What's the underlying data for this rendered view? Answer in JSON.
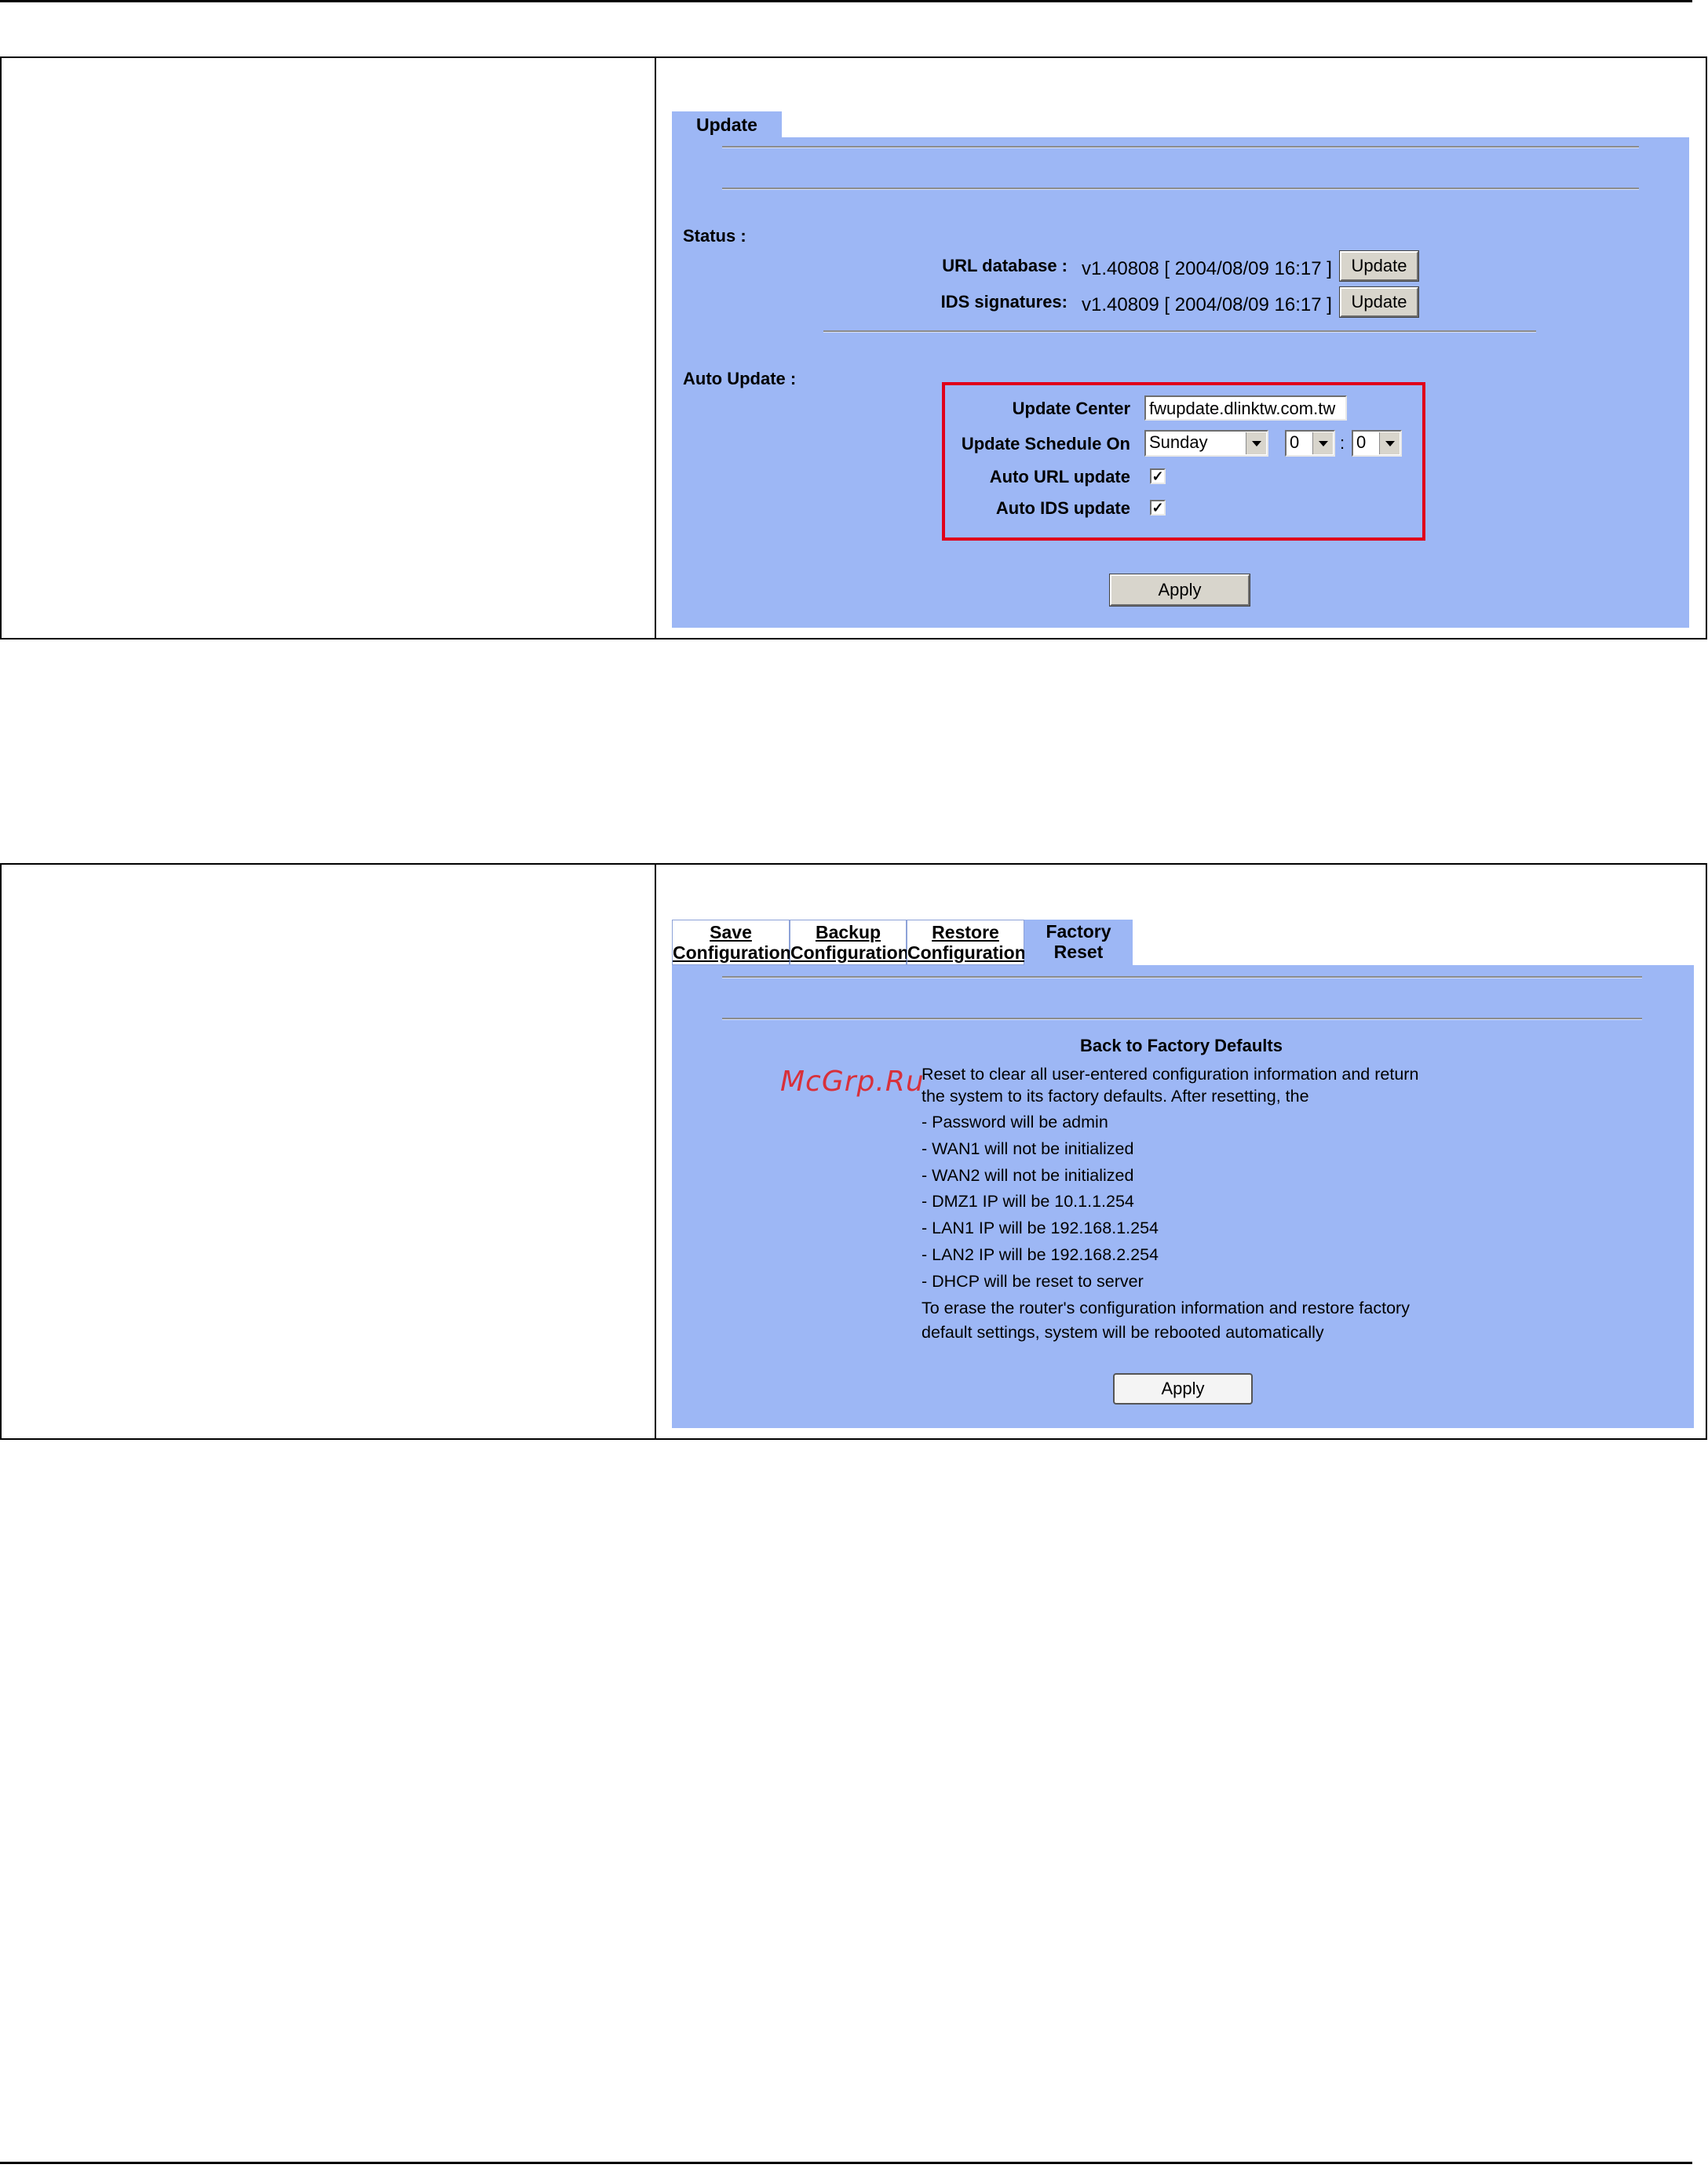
{
  "watermark": "McGrp.Ru",
  "update_panel": {
    "tab": "Update",
    "status_heading": "Status :",
    "url_label": "URL database :",
    "url_value": "v1.40808 [ 2004/08/09 16:17 ]",
    "url_button": "Update",
    "ids_label": "IDS signatures:",
    "ids_value": "v1.40809 [ 2004/08/09 16:17 ]",
    "ids_button": "Update",
    "auto_heading": "Auto Update :",
    "center_label": "Update Center",
    "center_value": "fwupdate.dlinktw.com.tw",
    "schedule_label": "Update Schedule On",
    "schedule_day": "Sunday",
    "schedule_hour": "0",
    "schedule_sep": ":",
    "schedule_minute": "0",
    "auto_url_label": "Auto URL update",
    "auto_url_checked": true,
    "auto_ids_label": "Auto IDS update",
    "auto_ids_checked": true,
    "apply": "Apply",
    "check_mark": "✓"
  },
  "factory_panel": {
    "tabs": [
      {
        "line1": "Save",
        "line2": "Configuration"
      },
      {
        "line1": "Backup",
        "line2": "Configuration"
      },
      {
        "line1": "Restore",
        "line2": "Configuration"
      }
    ],
    "active_tab": {
      "line1": "Factory",
      "line2": "Reset"
    },
    "heading": "Back to Factory Defaults",
    "intro1": "Reset to clear all user-entered configuration information and return",
    "intro2": "the system to its factory defaults. After resetting, the",
    "items": [
      "- Password will be admin",
      "- WAN1 will not be initialized",
      "- WAN2 will not be initialized",
      "- DMZ1 IP will be 10.1.1.254",
      "- LAN1 IP will be 192.168.1.254",
      "- LAN2 IP will be 192.168.2.254",
      "- DHCP will be reset to server"
    ],
    "outro1": "To erase the router's configuration information and restore factory",
    "outro2": "default settings, system will be rebooted automatically",
    "apply": "Apply"
  }
}
